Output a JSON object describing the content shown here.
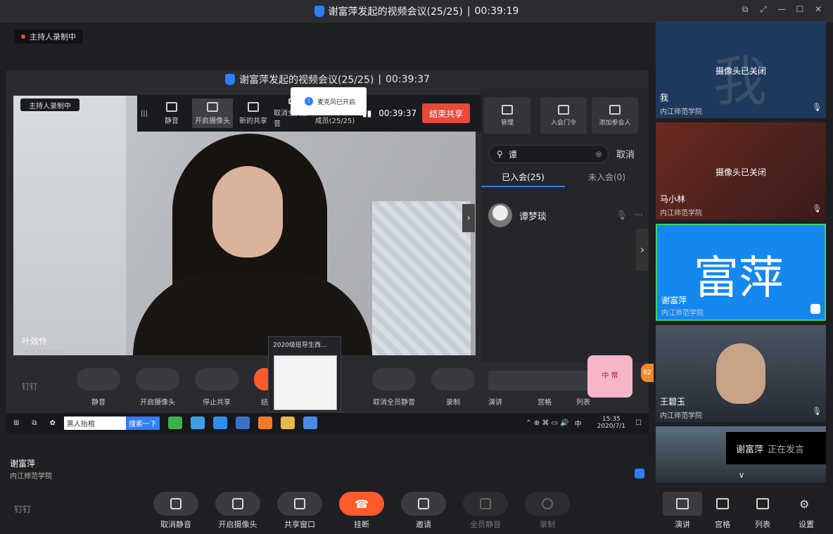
{
  "window": {
    "title": "谢富萍发起的视频会议(25/25)",
    "separator": "|",
    "time": "00:39:19"
  },
  "recording": {
    "label": "主持人录制中"
  },
  "shared_screen": {
    "title": "谢富萍发起的视频会议(25/25)",
    "time": "00:39:37",
    "camera": {
      "name": "叶效伶",
      "school": "内江师范学院",
      "recording": "主持人录制中"
    },
    "toolbar": {
      "mute": "静音",
      "camera": "开启摄像头",
      "new_share": "新的共享",
      "unmute_all": "取消全员静音",
      "members": "成员(25/25)",
      "time": "00:39:37",
      "end_share": "结束共享"
    },
    "mic_tip": "麦克风已开启",
    "panel": {
      "manage": "管理",
      "invite_link": "入会门令",
      "add_member": "添加参会人",
      "search_value": "谭",
      "cancel": "取消",
      "tab_joined": "已入会(25)",
      "tab_not_joined": "未入会(0)",
      "member_name": "谭梦琰"
    },
    "bottom": {
      "ding": "钉钉",
      "mute": "静音",
      "camera": "开启摄像头",
      "stop_share": "停止共享",
      "end": "结",
      "unmute_all": "取消全员静音",
      "record": "录制",
      "lecture": "演讲",
      "grid": "宫格",
      "list": "列表"
    },
    "thumb_title": "2020级班导生西...",
    "taskbar": {
      "search": "黑人抬棺",
      "search_btn": "搜索一下",
      "ime": "中",
      "time": "15:35",
      "date": "2020/7/1"
    },
    "badge": "82",
    "sticker": "中 幣"
  },
  "tiles": [
    {
      "big": "我",
      "status": "摄像头已关闭",
      "name": "我",
      "school": "内江师范学院"
    },
    {
      "status": "摄像头已关闭",
      "name": "马小林",
      "school": "内江师范学院"
    },
    {
      "big": "富萍",
      "name": "谢富萍",
      "school": "内江师范学院"
    },
    {
      "name": "王碧玉",
      "school": "内江师范学院"
    }
  ],
  "speaking": {
    "name": "谢富萍",
    "status": "正在发言"
  },
  "presenter": {
    "name": "谢富萍",
    "school": "内江师范学院"
  },
  "bottombar": {
    "logo": "钉钉",
    "unmute": "取消静音",
    "camera": "开启摄像头",
    "share_window": "共享窗口",
    "hangup": "挂断",
    "invite": "邀请",
    "mute_all": "全员静音",
    "record": "录制",
    "lecture": "演讲",
    "grid": "宫格",
    "list": "列表",
    "settings": "设置"
  },
  "colors": {
    "accent": "#2f7cf6",
    "danger": "#e8493a",
    "hangup": "#ff5a2c",
    "active_tile": "#1588f0"
  }
}
